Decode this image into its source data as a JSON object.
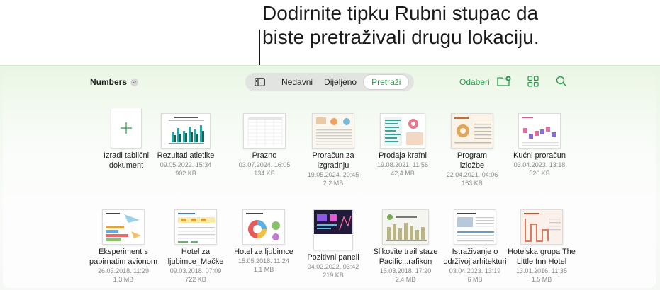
{
  "callout": {
    "line1": "Dodirnite tipku Rubni stupac da",
    "line2": "biste pretraživali drugu lokaciju."
  },
  "toolbar": {
    "app_name": "Numbers",
    "tabs": [
      "Nedavni",
      "Dijeljeno",
      "Pretraži"
    ],
    "active_tab": "Pretraži",
    "select_label": "Odaberi",
    "accent_color": "#2b9a4b"
  },
  "icons": {
    "sidebar": "sidebar-icon",
    "new_folder": "folder-plus-icon",
    "grid": "grid-view-icon",
    "search": "search-icon"
  },
  "files": [
    {
      "name1": "Izradi tablični",
      "name2": "dokument",
      "date": "",
      "size": ""
    },
    {
      "name1": "Rezultati atletike",
      "name2": "",
      "date": "09.05.2022. 15:34",
      "size": "902 KB"
    },
    {
      "name1": "Prazno",
      "name2": "",
      "date": "03.07.2024. 16:05",
      "size": "134 KB"
    },
    {
      "name1": "Proračun za",
      "name2": "izgradnju",
      "date": "19.05.2024. 20:45",
      "size": "2,2 MB"
    },
    {
      "name1": "Prodaja krafni",
      "name2": "",
      "date": "19.08.2021. 11:56",
      "size": "42,4 MB"
    },
    {
      "name1": "Program",
      "name2": "izložbe",
      "date": "22.04.2021. 04:06",
      "size": "163 KB"
    },
    {
      "name1": "Kućni proračun",
      "name2": "",
      "date": "03.04.2023. 13:18",
      "size": "526 KB"
    },
    {
      "name1": "Eksperiment s",
      "name2": "papirnatim avionom",
      "date": "26.03.2018. 11:29",
      "size": "1,3 MB"
    },
    {
      "name1": "Hotel za",
      "name2": "ljubimce_Mačke",
      "date": "09.03.2018. 07:09",
      "size": "722 KB"
    },
    {
      "name1": "Hotel za ljubimce",
      "name2": "",
      "date": "15.05.2018. 11:24",
      "size": "1,1 MB"
    },
    {
      "name1": "Pozitivni paneli",
      "name2": "",
      "date": "04.02.2022. 03:42",
      "size": "219 KB"
    },
    {
      "name1": "Slikovite trail staze",
      "name2": "Pacific...rafikon",
      "date": "16.03.2018. 17:20",
      "size": "2,4 MB"
    },
    {
      "name1": "Istraživanje o",
      "name2": "održivoj arhitekturi",
      "date": "03.04.2023. 13:19",
      "size": "6 MB"
    },
    {
      "name1": "Hotelska grupa The",
      "name2": "Little Inn Hotel",
      "date": "13.01.2016. 11:35",
      "size": "1,5 MB"
    }
  ]
}
